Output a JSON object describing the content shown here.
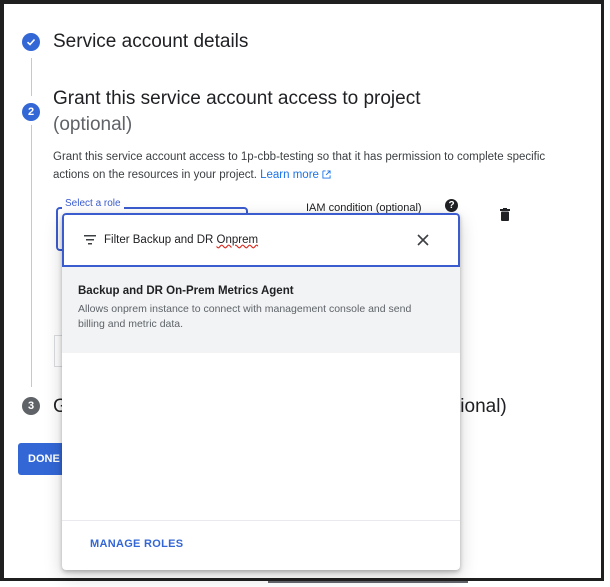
{
  "steps": [
    {
      "number": "",
      "title": "Service account details",
      "status": "completed",
      "icon": "check-circle-icon"
    },
    {
      "number": "2",
      "title": "Grant this service account access to project",
      "optional_label": "(optional)",
      "status": "active"
    },
    {
      "number": "3",
      "title_left": "G",
      "title_right": "tional)",
      "status": "pending"
    }
  ],
  "grant": {
    "description": "Grant this service account access to 1p-cbb-testing so that it has permission to complete specific actions on the resources in your project.",
    "learn_more": "Learn more",
    "role_field_label": "Select a role",
    "iam_condition_label": "IAM condition (optional)",
    "help_icon_glyph": "?"
  },
  "done_label": "DONE",
  "dropdown": {
    "filter_prefix": "Filter",
    "filter_query_start": "Backup and DR ",
    "filter_query_misspelled": "Onprem",
    "options": [
      {
        "title": "Backup and DR On-Prem Metrics Agent",
        "description": "Allows onprem instance to connect with management console and send billing and metric data."
      }
    ],
    "manage_roles": "MANAGE ROLES"
  },
  "colors": {
    "accent": "#3367d6",
    "focus_border": "#3b5ccf",
    "selected_row": "#f1f3f4"
  }
}
